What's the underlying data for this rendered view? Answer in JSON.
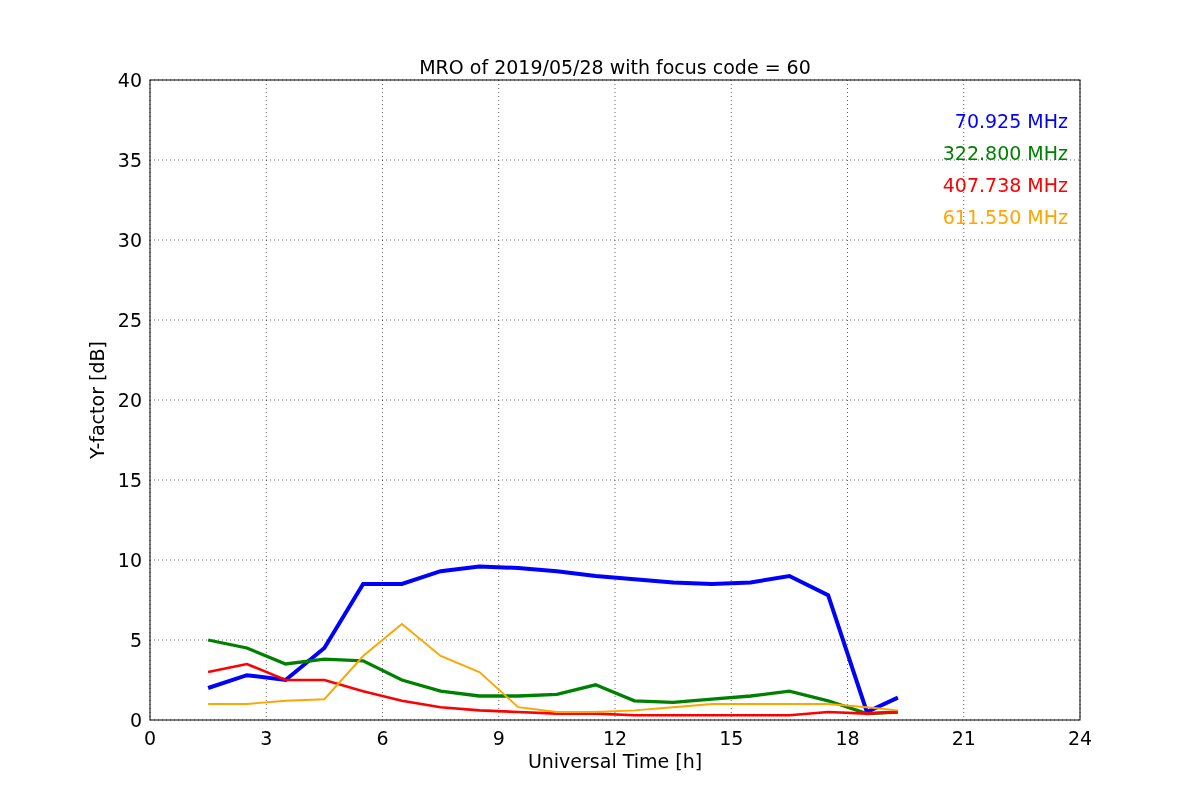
{
  "figure": {
    "chart_data": {
      "type": "line",
      "title": "MRO of 2019/05/28 with focus code = 60",
      "xlabel": "Universal Time [h]",
      "ylabel": "Y-factor [dB]",
      "x": [
        1.5,
        2.5,
        3.5,
        4.5,
        5.5,
        6.5,
        7.5,
        8.5,
        9.5,
        10.5,
        11.5,
        12.5,
        13.5,
        14.5,
        15.5,
        16.5,
        17.5,
        18.5,
        19.3
      ],
      "series": [
        {
          "name": "70.925 MHz",
          "color": "#0000ff",
          "values": [
            2,
            2.8,
            2.5,
            4.5,
            8.5,
            8.5,
            9.3,
            9.6,
            9.5,
            9.3,
            9,
            8.8,
            8.6,
            8.5,
            8.6,
            9,
            7.8,
            0.5,
            1.4
          ]
        },
        {
          "name": "322.800 MHz",
          "color": "#008000",
          "values": [
            5,
            4.5,
            3.5,
            3.8,
            3.7,
            2.5,
            1.8,
            1.5,
            1.5,
            1.6,
            2.2,
            1.2,
            1.1,
            1.3,
            1.5,
            1.8,
            1.2,
            0.4,
            0.5
          ]
        },
        {
          "name": "407.738 MHz",
          "color": "#ff0000",
          "values": [
            3,
            3.5,
            2.5,
            2.5,
            1.8,
            1.2,
            0.8,
            0.6,
            0.5,
            0.4,
            0.4,
            0.3,
            0.3,
            0.3,
            0.3,
            0.3,
            0.5,
            0.4,
            0.5
          ]
        },
        {
          "name": "611.550 MHz",
          "color": "#ffa500",
          "values": [
            1,
            1,
            1.2,
            1.3,
            4,
            6,
            4,
            3,
            0.8,
            0.5,
            0.5,
            0.6,
            0.8,
            1,
            1,
            1,
            1,
            0.8,
            0.6
          ]
        }
      ],
      "xlim": [
        0,
        24
      ],
      "ylim": [
        0,
        40
      ],
      "xticks": [
        0,
        3,
        6,
        9,
        12,
        15,
        18,
        21,
        24
      ],
      "yticks": [
        0,
        5,
        10,
        15,
        20,
        25,
        30,
        35,
        40
      ],
      "grid": true
    }
  }
}
